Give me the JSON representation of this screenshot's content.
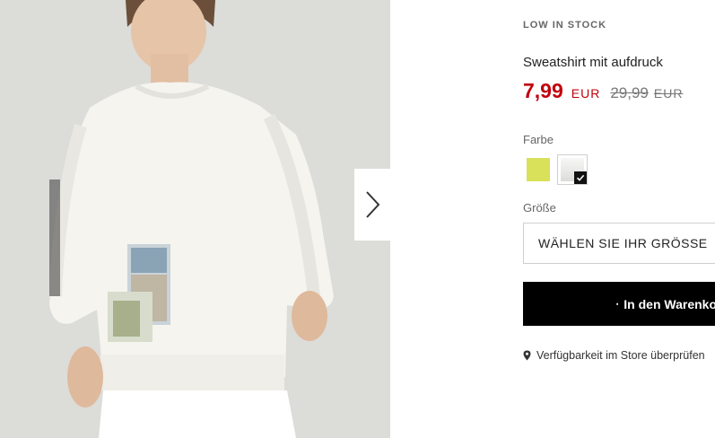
{
  "gallery": {
    "image_alt": "Model in white printed sweatshirt",
    "next_icon": "chevron-right-icon"
  },
  "product": {
    "stock_status": "LOW IN STOCK",
    "title": "Sweatshirt mit aufdruck",
    "price_current": "7,99",
    "price_current_currency": "EUR",
    "price_old": "29,99",
    "price_old_currency": "EUR"
  },
  "color": {
    "label": "Farbe",
    "swatches": [
      {
        "name": "yellow",
        "color": "#d9e05a",
        "selected": false
      },
      {
        "name": "white",
        "color": "#f2f2f0",
        "selected": true
      }
    ]
  },
  "size": {
    "label": "Größe",
    "select_text": "WÄHLEN SIE IHR GRÖSSE"
  },
  "cart": {
    "button_label": "In den Warenkorb",
    "icon": "shopping-bag-icon"
  },
  "store": {
    "link_text": "Verfügbarkeit im Store überprüfen",
    "icon": "map-pin-icon"
  },
  "colors": {
    "price_red": "#c0000c",
    "button_black": "#000000"
  }
}
